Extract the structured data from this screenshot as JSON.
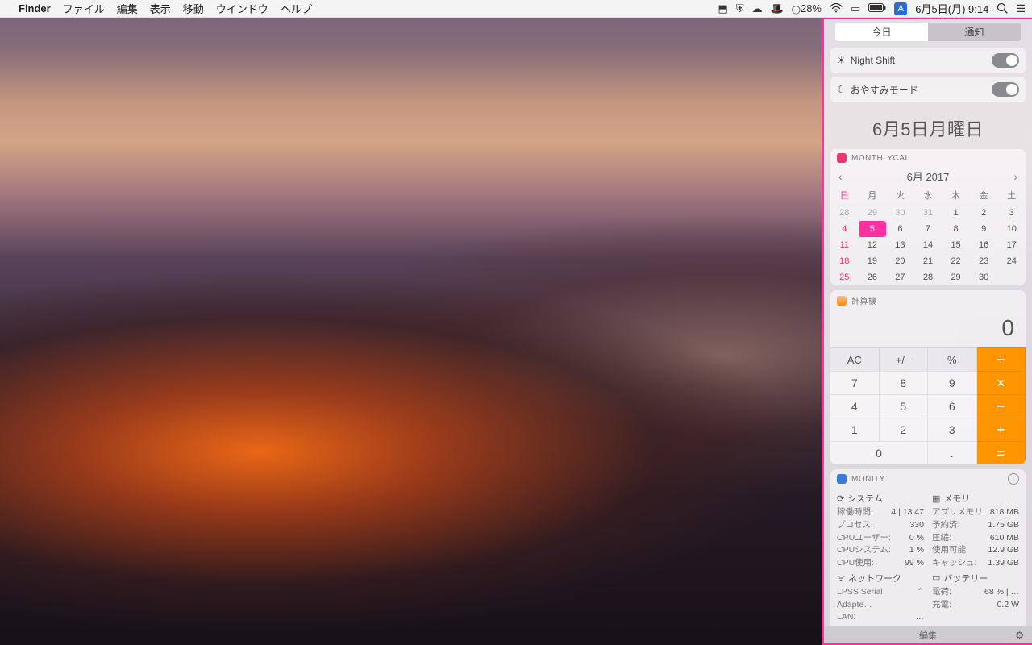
{
  "menubar": {
    "app": "Finder",
    "items": [
      "ファイル",
      "編集",
      "表示",
      "移動",
      "ウインドウ",
      "ヘルプ"
    ],
    "battery_pct": "28%",
    "input_method": "A",
    "datetime": "6月5日(月) 9:14"
  },
  "nc": {
    "tabs": {
      "today": "今日",
      "notifications": "通知"
    },
    "toggles": {
      "night_shift": "Night Shift",
      "dnd": "おやすみモード"
    },
    "date_heading": "6月5日月曜日",
    "calendar": {
      "title": "MONTHLYCAL",
      "month_label": "6月 2017",
      "dow": [
        "日",
        "月",
        "火",
        "水",
        "木",
        "金",
        "土"
      ],
      "leading_out": [
        28,
        29,
        30,
        31
      ],
      "days": [
        1,
        2,
        3,
        4,
        5,
        6,
        7,
        8,
        9,
        10,
        11,
        12,
        13,
        14,
        15,
        16,
        17,
        18,
        19,
        20,
        21,
        22,
        23,
        24,
        25,
        26,
        27,
        28,
        29,
        30
      ],
      "today": 5
    },
    "calculator": {
      "title": "計算機",
      "display": "0",
      "funcs": [
        "AC",
        "+/−",
        "%"
      ],
      "ops": [
        "÷",
        "×",
        "−",
        "+",
        "="
      ],
      "digits": [
        "7",
        "8",
        "9",
        "4",
        "5",
        "6",
        "1",
        "2",
        "3",
        "0",
        "."
      ]
    },
    "monity": {
      "title": "MONITY",
      "system": {
        "heading": "システム",
        "rows": [
          {
            "k": "稼働時間:",
            "v": "4 | 13:47"
          },
          {
            "k": "プロセス:",
            "v": "330"
          },
          {
            "k": "CPUユーザー:",
            "v": "0 %"
          },
          {
            "k": "CPUシステム:",
            "v": "1 %"
          },
          {
            "k": "CPU使用:",
            "v": "99 %"
          }
        ]
      },
      "memory": {
        "heading": "メモリ",
        "rows": [
          {
            "k": "アプリメモリ:",
            "v": "818 MB"
          },
          {
            "k": "予約済:",
            "v": "1.75 GB"
          },
          {
            "k": "圧縮:",
            "v": "610 MB"
          },
          {
            "k": "使用可能:",
            "v": "12.9 GB"
          },
          {
            "k": "キャッシュ:",
            "v": "1.39 GB"
          }
        ]
      },
      "network": {
        "heading": "ネットワーク",
        "rows": [
          {
            "k": "LPSS Serial Adapte…",
            "v": "⌃"
          },
          {
            "k": "LAN:",
            "v": "…"
          }
        ]
      },
      "battery": {
        "heading": "バッテリー",
        "rows": [
          {
            "k": "電荷:",
            "v": "68 % | …"
          },
          {
            "k": "充電:",
            "v": "0.2 W"
          }
        ]
      }
    },
    "edit_label": "編集"
  }
}
